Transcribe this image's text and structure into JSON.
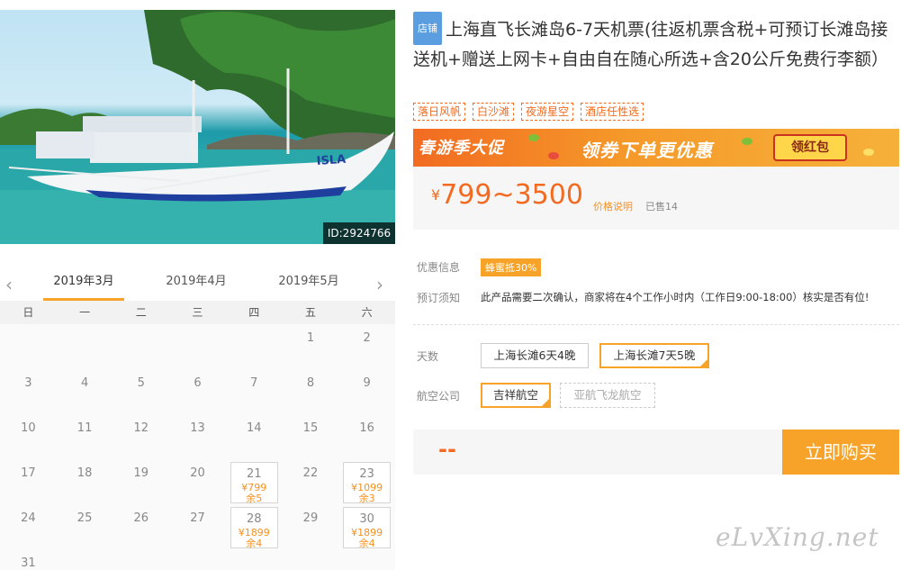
{
  "photo": {
    "id_label": "ID:2924766",
    "boat_name": "ISLA"
  },
  "calendar": {
    "prev_icon": "chevron-left-icon",
    "next_icon": "chevron-right-icon",
    "months": [
      {
        "label": "2019年3月",
        "active": true
      },
      {
        "label": "2019年4月",
        "active": false
      },
      {
        "label": "2019年5月",
        "active": false
      }
    ],
    "weekdays": [
      "日",
      "一",
      "二",
      "三",
      "四",
      "五",
      "六"
    ],
    "weeks": [
      [
        null,
        null,
        null,
        null,
        null,
        {
          "day": "1"
        },
        {
          "day": "2"
        }
      ],
      [
        {
          "day": "3"
        },
        {
          "day": "4"
        },
        {
          "day": "5"
        },
        {
          "day": "6"
        },
        {
          "day": "7"
        },
        {
          "day": "8"
        },
        {
          "day": "9"
        }
      ],
      [
        {
          "day": "10"
        },
        {
          "day": "11"
        },
        {
          "day": "12"
        },
        {
          "day": "13"
        },
        {
          "day": "14"
        },
        {
          "day": "15"
        },
        {
          "day": "16"
        }
      ],
      [
        {
          "day": "17"
        },
        {
          "day": "18"
        },
        {
          "day": "19"
        },
        {
          "day": "20"
        },
        {
          "day": "21",
          "price": "¥799",
          "stock": "余5"
        },
        {
          "day": "22"
        },
        {
          "day": "23",
          "price": "¥1099",
          "stock": "余3"
        }
      ],
      [
        {
          "day": "24"
        },
        {
          "day": "25"
        },
        {
          "day": "26"
        },
        {
          "day": "27"
        },
        {
          "day": "28",
          "price": "¥1899",
          "stock": "余4"
        },
        {
          "day": "29"
        },
        {
          "day": "30",
          "price": "¥1899",
          "stock": "余4"
        }
      ],
      [
        {
          "day": "31"
        },
        null,
        null,
        null,
        null,
        null,
        null
      ]
    ]
  },
  "product": {
    "shop_badge": "店铺",
    "title": "上海直飞长滩岛6-7天机票(往返机票含税+可预订长滩岛接送机+赠送上网卡+自由自在随心所选+含20公斤免费行李额）",
    "tags": [
      "落日风帆",
      "白沙滩",
      "夜游星空",
      "酒店任性选"
    ]
  },
  "promo": {
    "left_text": "春游季大促",
    "main_text": "领券下单更优惠",
    "button_label": "领红包"
  },
  "price": {
    "currency": "¥",
    "range": "799~3500",
    "note_link": "价格说明",
    "sold": "已售14"
  },
  "info": {
    "discount_label": "优惠信息",
    "discount_badge": "蜂蜜抵30%",
    "booking_label": "预订须知",
    "booking_text": "此产品需要二次确认，商家将在4个工作小时内（工作日9:00-18:00）核实是否有位!"
  },
  "options": {
    "days_label": "天数",
    "days": [
      {
        "label": "上海长滩6天4晚",
        "state": "normal"
      },
      {
        "label": "上海长滩7天5晚",
        "state": "selected"
      }
    ],
    "airline_label": "航空公司",
    "airlines": [
      {
        "label": "吉祥航空",
        "state": "selected"
      },
      {
        "label": "亚航飞龙航空",
        "state": "disabled"
      }
    ]
  },
  "buy": {
    "price_placeholder": "--",
    "button_label": "立即购买"
  },
  "watermark": "eLvXing.net",
  "colors": {
    "accent": "#f7a329",
    "price": "#f26b21",
    "badge_blue": "#5a9ee0"
  }
}
